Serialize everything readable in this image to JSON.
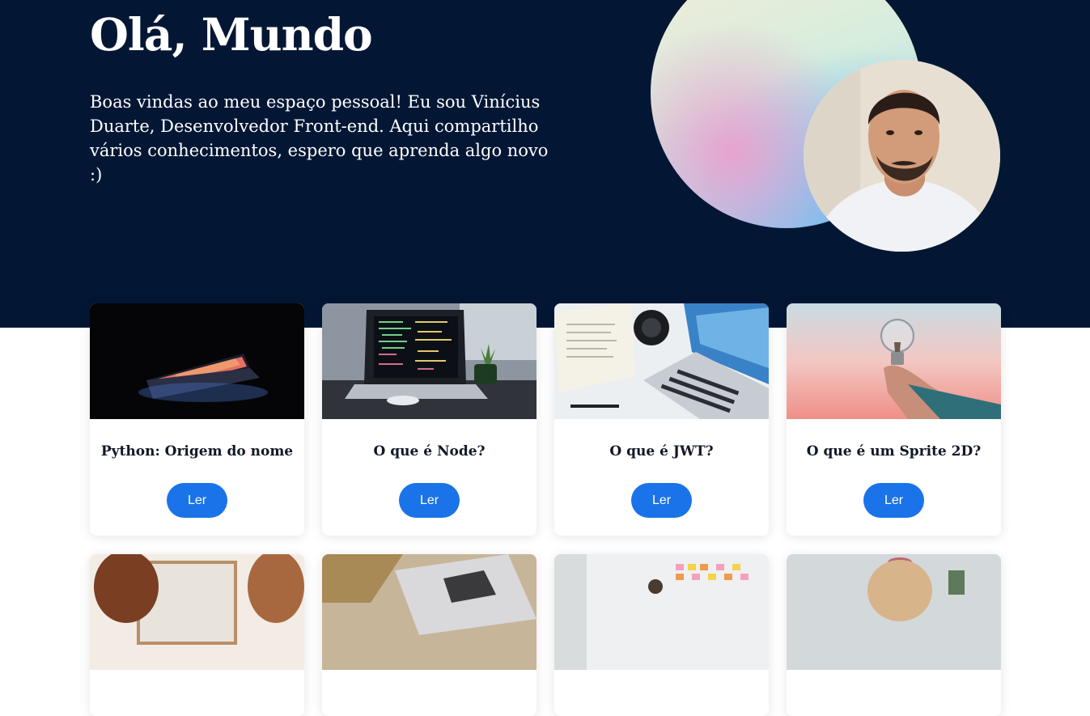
{
  "hero": {
    "title": "Olá, Mundo",
    "text": "Boas vindas ao meu espaço pessoal! Eu sou Vinícius Duarte, Desenvolvedor Front-end. Aqui compartilho vários conhecimentos, espero que aprenda algo novo :)"
  },
  "colors": {
    "hero_background": "#031735",
    "button": "#1a73e8",
    "title_text": "#111827"
  },
  "posts": [
    {
      "title": "Python: Origem do nome",
      "button_label": "Ler",
      "image": "dark-laptop-photo"
    },
    {
      "title": "O que é Node?",
      "button_label": "Ler",
      "image": "code-laptop-photo"
    },
    {
      "title": "O que é JWT?",
      "button_label": "Ler",
      "image": "desk-laptop-photo"
    },
    {
      "title": "O que é um Sprite 2D?",
      "button_label": "Ler",
      "image": "lightbulb-photo"
    }
  ],
  "posts_row2_images": [
    "women-window-photo",
    "person-laptop-photo",
    "sticky-notes-photo",
    "person-desk-photo"
  ]
}
